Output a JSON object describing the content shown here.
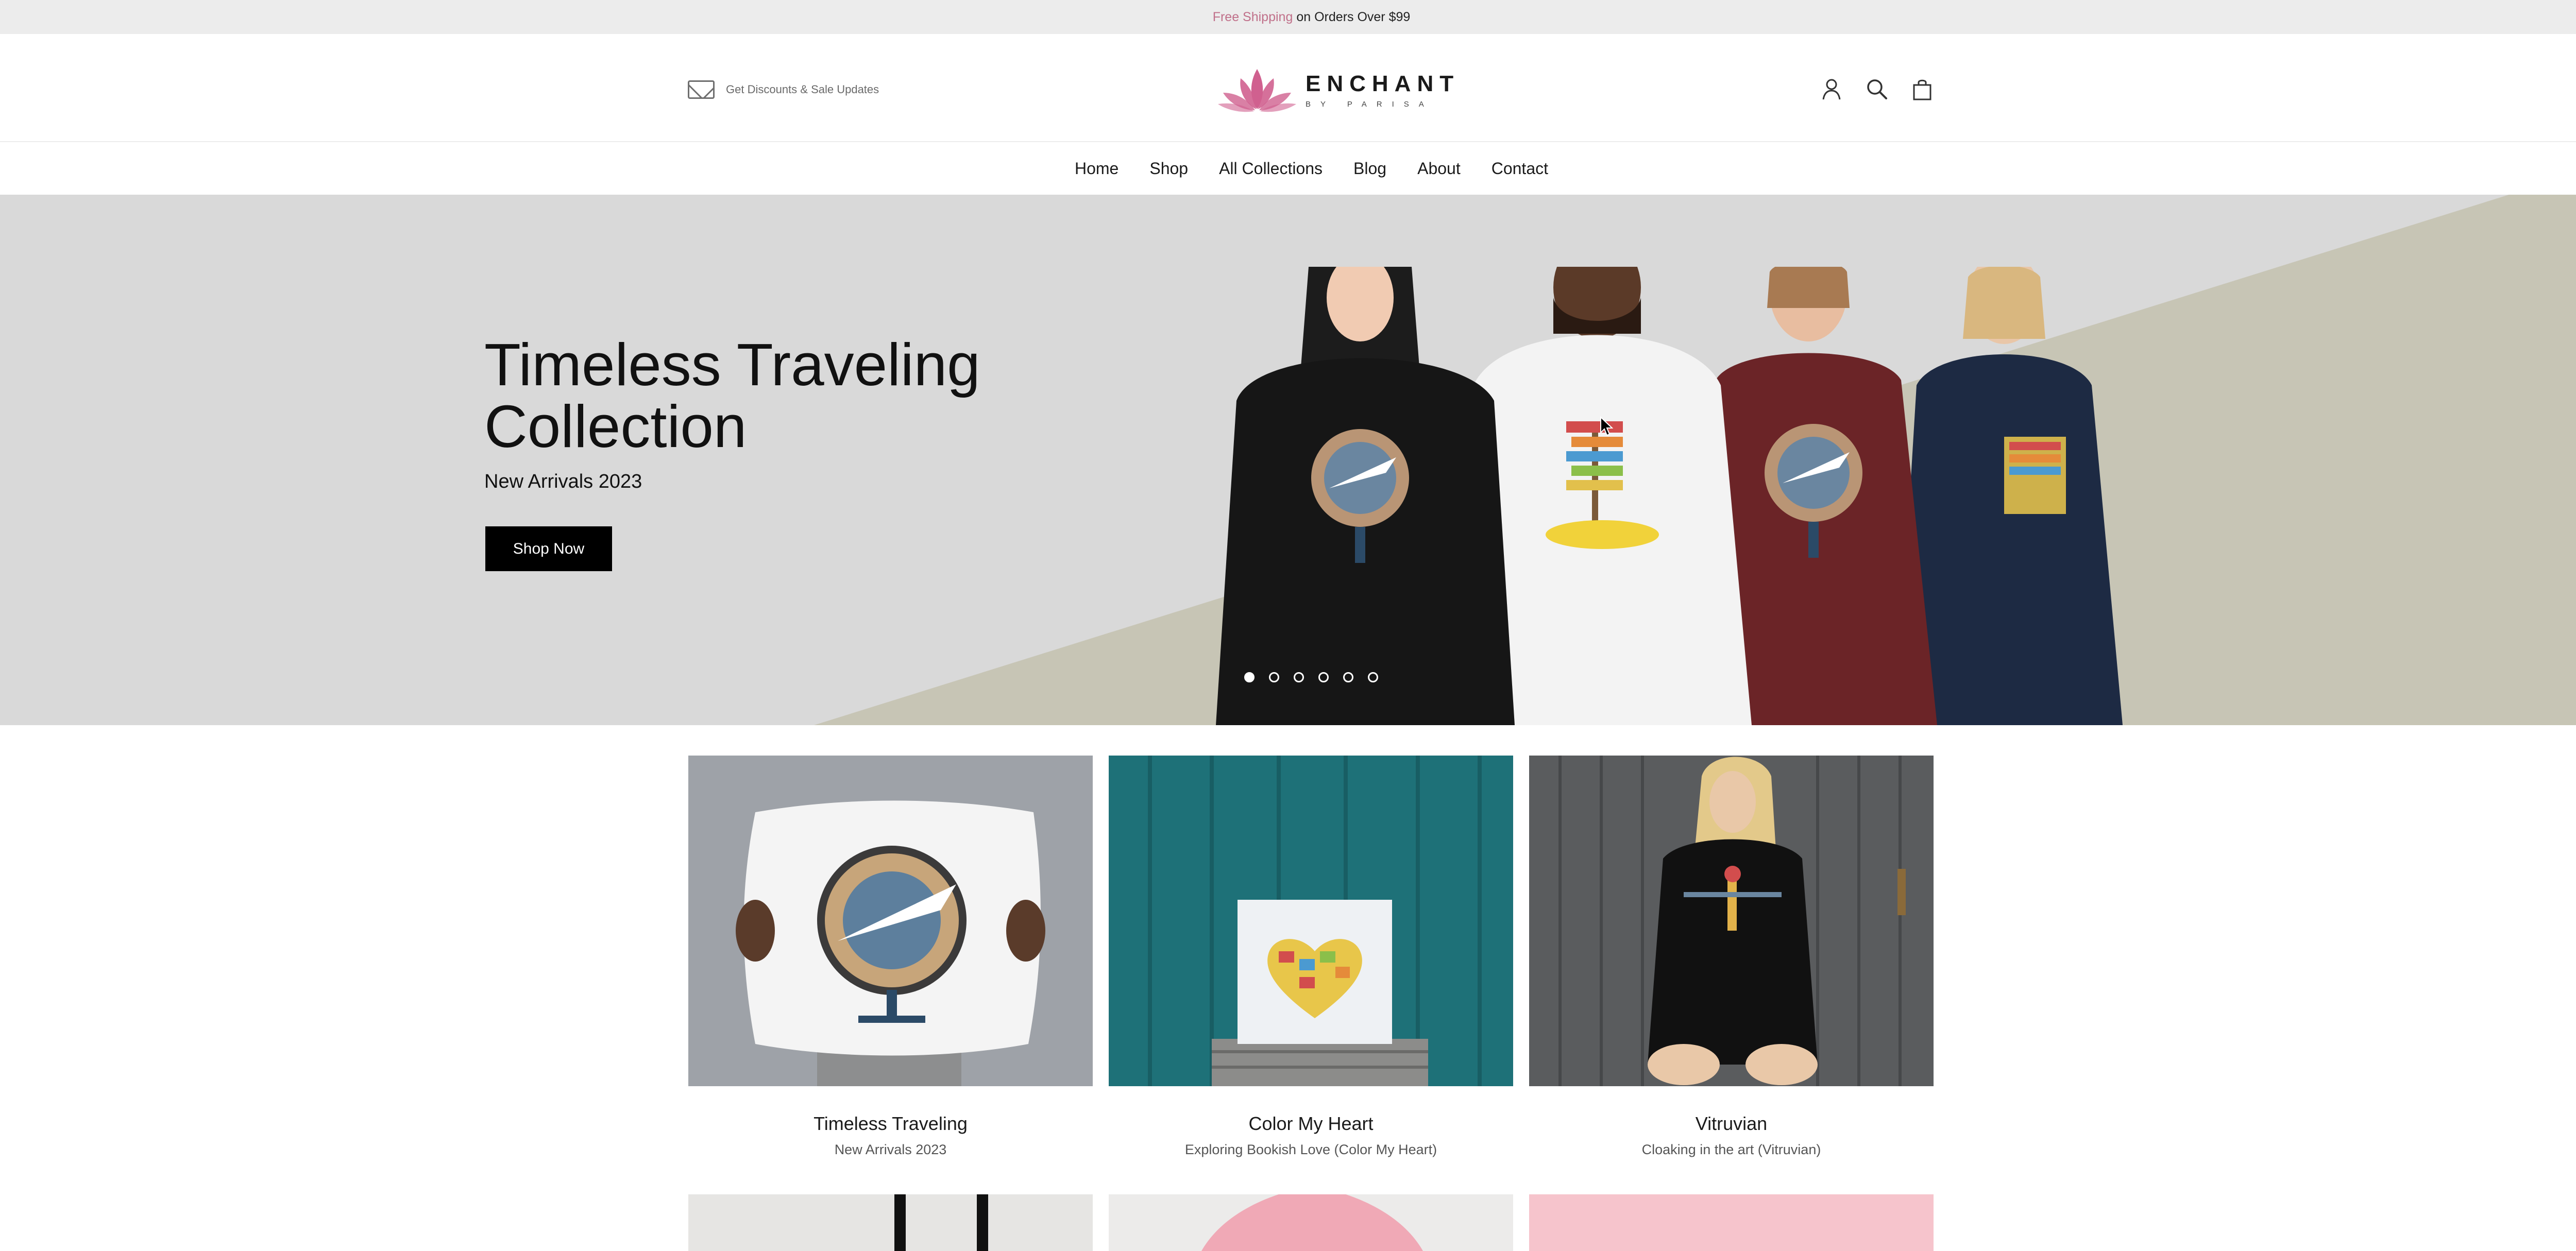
{
  "announcement": {
    "highlight": "Free Shipping",
    "text": "on Orders Over $99"
  },
  "header": {
    "newsletter_label": "Get Discounts & Sale Updates",
    "logo_brand": "ENCHANT",
    "logo_sub": "BY PARISA",
    "icons": [
      "account-icon",
      "search-icon",
      "cart-icon"
    ]
  },
  "nav": {
    "items": [
      "Home",
      "Shop",
      "All Collections",
      "Blog",
      "About",
      "Contact"
    ]
  },
  "hero": {
    "title_line1": "Timeless Traveling",
    "title_line2": "Collection",
    "subtitle": "New Arrivals 2023",
    "button": "Shop Now",
    "slides_count": 6,
    "active_slide": 1
  },
  "collections": [
    {
      "title": "Timeless Traveling",
      "subtitle": "New Arrivals 2023"
    },
    {
      "title": "Color My Heart",
      "subtitle": "Exploring Bookish Love (Color My Heart)"
    },
    {
      "title": "Vitruvian",
      "subtitle": "Cloaking in the art (Vitruvian)"
    }
  ],
  "colors": {
    "announcement_accent": "#c0708a",
    "logo_pink": "#d0608f",
    "hero_bg": "#d9d9d9",
    "hero_diagonal": "#c7c5b5"
  }
}
